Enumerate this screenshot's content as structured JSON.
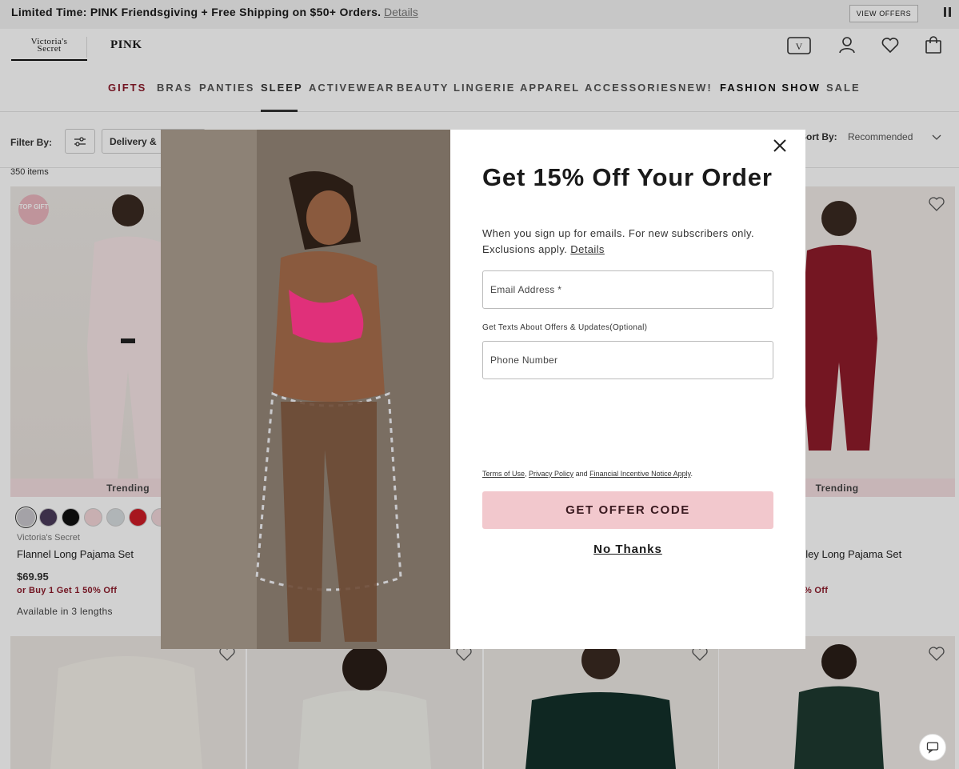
{
  "promo": {
    "text": "Limited Time: PINK Friendsgiving + Free Shipping on $50+ Orders.",
    "details": "Details",
    "view_offers": "VIEW OFFERS"
  },
  "brands": {
    "vs_line1": "Victoria's",
    "vs_line2": "Secret",
    "pink": "PINK"
  },
  "nav": {
    "items": [
      "GIFTS",
      "BRAS",
      "PANTIES",
      "SLEEP",
      "ACTIVEWEAR",
      "BEAUTY",
      "LINGERIE",
      "APPAREL",
      "ACCESSORIES",
      "NEW!",
      "FASHION SHOW",
      "SALE"
    ],
    "active": "SLEEP"
  },
  "filters": {
    "label": "Filter By:",
    "delivery": "Delivery &",
    "sort_label": "Sort By:",
    "sort_value": "Recommended"
  },
  "items_count": "350 items",
  "products": [
    {
      "badge": "TOP GIFT",
      "trending": "Trending",
      "brand": "Victoria's Secret",
      "name": "Flannel Long Pajama Set",
      "price": "$69.95",
      "offer": "or Buy 1 Get 1 50% Off",
      "availability": "Available in 3 lengths",
      "swatches": [
        "#c9c6cc",
        "#4a3a5a",
        "#111111",
        "#f4d6d8",
        "#d7dde0",
        "#cc1b26",
        "#f1d6da"
      ]
    },
    {
      "trending": "Trending",
      "name": "nley Long Pajama Set",
      "offer": "% Off"
    }
  ],
  "modal": {
    "title": "Get 15% Off Your Order",
    "subtitle": "When you sign up for emails. For new subscribers only. Exclusions apply.",
    "details": "Details",
    "email_placeholder": "Email Address *",
    "texts_label": "Get Texts About Offers & Updates(Optional)",
    "phone_placeholder": "Phone Number",
    "legal_terms": "Terms of Use",
    "legal_privacy": "Privacy Policy",
    "legal_and": "and",
    "legal_incentive": "Financial Incentive Notice Apply",
    "cta": "GET OFFER CODE",
    "no_thanks": "No Thanks"
  },
  "colors": {
    "accent": "#8b1a2a",
    "cta": "#f2c8cd",
    "trending": "#f3dde0"
  }
}
